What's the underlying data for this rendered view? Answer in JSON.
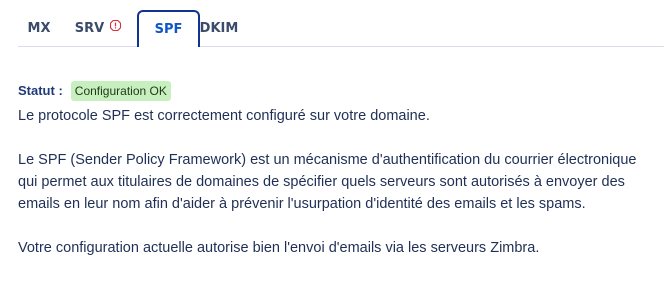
{
  "tabs": [
    {
      "label": "MX"
    },
    {
      "label": "SRV",
      "icon": "warning-hexagon-icon",
      "icon_color": "#d6303c"
    },
    {
      "label": "SPF",
      "active": true
    },
    {
      "label": "DKIM"
    }
  ],
  "status": {
    "label": "Statut :",
    "badge": "Configuration OK",
    "badge_color": "#c8efc0"
  },
  "paragraphs": [
    "Le protocole SPF est correctement configuré sur votre domaine.",
    "Le SPF (Sender Policy Framework) est un mécanisme d'authentification du courrier électronique qui permet aux titulaires de domaines de spécifier quels serveurs sont autorisés à envoyer des emails en leur nom afin d'aider à prévenir l'usurpation d'identité des emails et les spams.",
    "Votre configuration actuelle autorise bien l'envoi d'emails via les serveurs Zimbra."
  ],
  "colors": {
    "active_tab": "#0e56c9",
    "active_border": "#12338f",
    "text": "#1f2f55"
  }
}
